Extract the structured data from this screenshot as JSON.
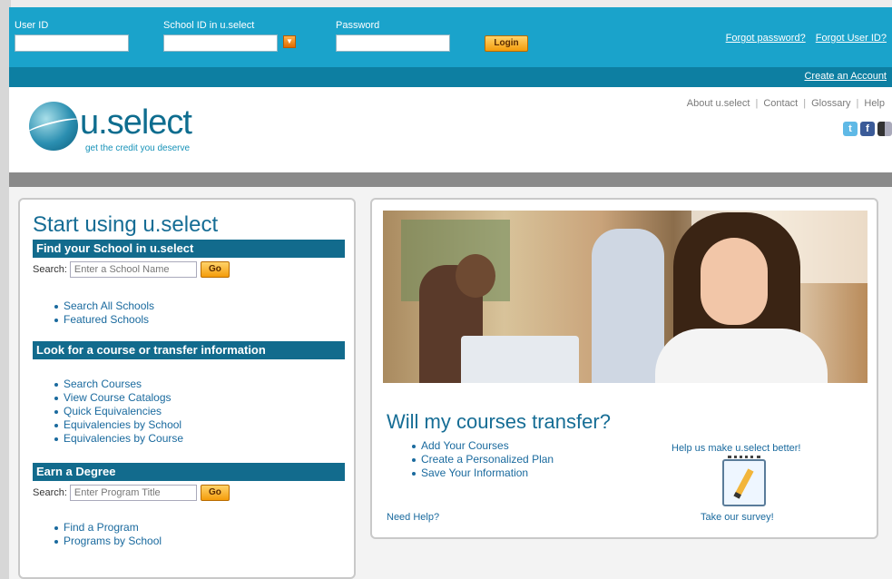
{
  "topbar": {
    "user_id_label": "User ID",
    "school_id_label": "School ID in u.select",
    "password_label": "Password",
    "login_label": "Login",
    "forgot_password": "Forgot password?",
    "forgot_user_id": "Forgot User ID?",
    "create_account": "Create an Account"
  },
  "header": {
    "logo_text": "u.select",
    "tagline": "get the credit you deserve",
    "nav": [
      "About u.select",
      "Contact",
      "Glossary",
      "Help"
    ],
    "social_icons": [
      "twitter-icon",
      "facebook-icon",
      "delicious-icon"
    ]
  },
  "left": {
    "title": "Start using u.select",
    "find_school": {
      "heading": "Find your School in u.select",
      "search_label": "Search:",
      "placeholder": "Enter a School Name",
      "go_label": "Go",
      "links": [
        "Search All Schools",
        "Featured Schools"
      ]
    },
    "course": {
      "heading": "Look for a course or transfer information",
      "links": [
        "Search Courses",
        "View Course Catalogs",
        "Quick Equivalencies",
        "Equivalencies by School",
        "Equivalencies by Course"
      ]
    },
    "degree": {
      "heading": "Earn a Degree",
      "search_label": "Search:",
      "placeholder": "Enter Program Title",
      "go_label": "Go",
      "links": [
        "Find a Program",
        "Programs by School"
      ]
    }
  },
  "right": {
    "title": "Will my courses transfer?",
    "links": [
      "Add Your Courses",
      "Create a Personalized Plan",
      "Save Your Information"
    ],
    "need_help": "Need Help?",
    "help_us": "Help us make u.select better!",
    "take_survey": "Take our survey!"
  },
  "colors": {
    "topbar": "#1aa3cb",
    "subbar": "#0d7fa2",
    "section_bar": "#126b8d",
    "link": "#1a6a9e",
    "button": "#f49c0b"
  }
}
